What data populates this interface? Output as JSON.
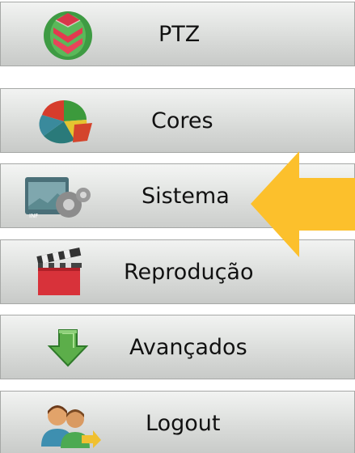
{
  "menu": {
    "items": [
      {
        "label": "PTZ",
        "icon": "ptz-icon"
      },
      {
        "label": "Cores",
        "icon": "colors-pie-icon"
      },
      {
        "label": "Sistema",
        "icon": "system-gears-icon"
      },
      {
        "label": "Reprodução",
        "icon": "clapperboard-icon"
      },
      {
        "label": "Avançados",
        "icon": "download-arrow-icon"
      },
      {
        "label": "Logout",
        "icon": "users-icon"
      }
    ],
    "selected": "Sistema"
  },
  "colors": {
    "pointer_arrow": "#fcc02c",
    "item_border": "#a6a8a6",
    "text": "#111111"
  }
}
